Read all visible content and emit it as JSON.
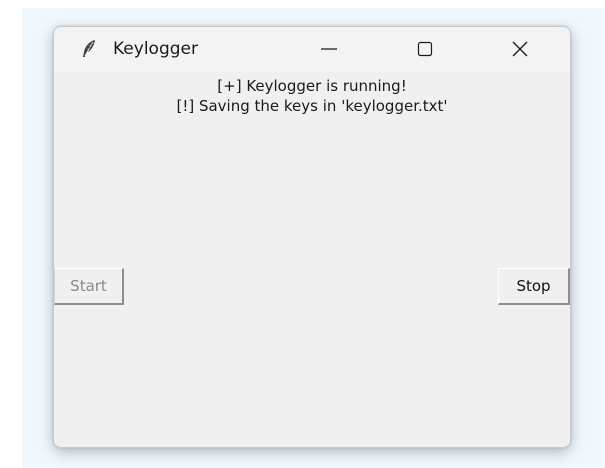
{
  "window": {
    "title": "Keylogger",
    "controls": {
      "minimize_icon": "minimize-icon",
      "maximize_icon": "maximize-icon",
      "close_icon": "close-icon"
    },
    "app_icon": "feather-icon"
  },
  "content": {
    "status_line": "[+] Keylogger is running!",
    "save_line": "[!] Saving the keys in 'keylogger.txt'"
  },
  "buttons": {
    "start_label": "Start",
    "start_enabled": false,
    "stop_label": "Stop",
    "stop_enabled": true
  },
  "colors": {
    "window_bg": "#f0f0f0",
    "backdrop": "#f0f7fd",
    "disabled_text": "#8a8a8a"
  }
}
